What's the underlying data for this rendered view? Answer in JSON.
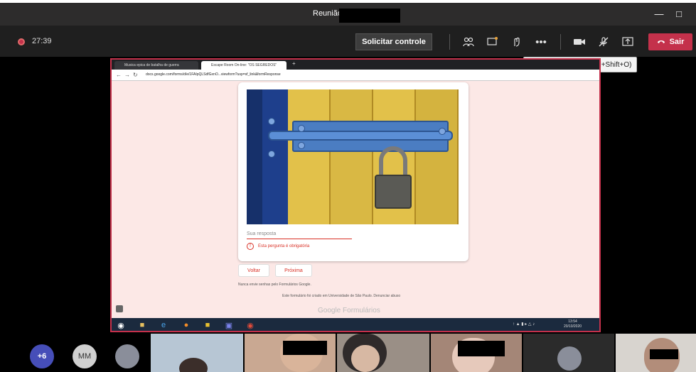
{
  "window": {
    "title": "Reunião"
  },
  "toolbar": {
    "timer": "27:39",
    "request_control": "Solicitar controle",
    "leave": "Sair"
  },
  "tooltip": "Desativar Câmera (Ctrl+Shift+O)",
  "browser": {
    "tabs": [
      {
        "label": "Musica epica de batalha de guerra"
      },
      {
        "label": "Escape Room On-line: \"OS SEGREDOS\""
      }
    ],
    "url": "docs.google.com/forms/d/e/1FAIpQLSdfGxnO...viewform?usp=sf_link&formResponse"
  },
  "form": {
    "response_placeholder": "Sua resposta",
    "required_message": "Esta pergunta é obrigatória",
    "back_button": "Voltar",
    "next_button": "Próxima",
    "password_note": "Nunca envie senhas pelo Formulários Google.",
    "owner_note": "Este formulário foi criado em Universidade de São Paulo. Denunciar abuso",
    "logo": "Google Formulários"
  },
  "taskbar": {
    "time": "13:54",
    "date": "20/10/2020"
  },
  "participants": {
    "overflow_count": "+6",
    "initials": "MM"
  }
}
